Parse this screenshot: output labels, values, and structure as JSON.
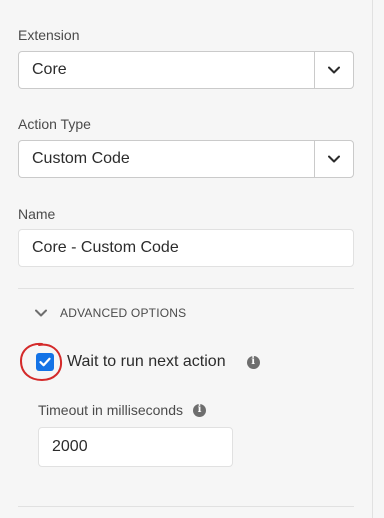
{
  "extension": {
    "label": "Extension",
    "value": "Core",
    "dropdown_icon": "chevron-down-icon"
  },
  "action_type": {
    "label": "Action Type",
    "value": "Custom Code",
    "dropdown_icon": "chevron-down-icon"
  },
  "name": {
    "label": "Name",
    "value": "Core - Custom Code"
  },
  "advanced": {
    "header": "ADVANCED OPTIONS",
    "toggle_icon": "chevron-down-icon",
    "expanded": true,
    "wait_checkbox": {
      "label": "Wait to run next action",
      "checked": true,
      "info_icon": "info-icon"
    },
    "timeout": {
      "label": "Timeout in milliseconds",
      "value": "2000",
      "info_icon": "info-icon"
    }
  },
  "annotation": {
    "shape": "hand-drawn-circle",
    "color": "#d42a2a"
  },
  "colors": {
    "accent": "#1473e6",
    "background": "#f6f6f6",
    "border": "#cacaca"
  }
}
